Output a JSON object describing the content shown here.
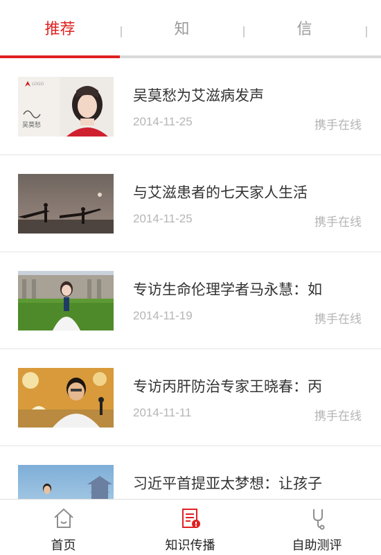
{
  "tabs": [
    {
      "label": "推荐",
      "active": true
    },
    {
      "label": "知",
      "active": false
    },
    {
      "label": "信",
      "active": false
    }
  ],
  "articles": [
    {
      "title": "吴莫愁为艾滋病发声",
      "date": "2014-11-25",
      "source": "携手在线",
      "thumb_icon": "portrait-woman-red-ribbon"
    },
    {
      "title": "与艾滋患者的七天家人生活",
      "date": "2014-11-25",
      "source": "携手在线",
      "thumb_icon": "silhouette-dancers-sunset"
    },
    {
      "title": "专访生命伦理学者马永慧：如",
      "date": "2014-11-19",
      "source": "携手在线",
      "thumb_icon": "woman-on-campus-lawn"
    },
    {
      "title": "专访丙肝防治专家王晓春：丙",
      "date": "2014-11-11",
      "source": "携手在线",
      "thumb_icon": "man-speaking-at-microphone"
    },
    {
      "title": "习近平首提亚太梦想：让孩子",
      "date": "",
      "source": "",
      "thumb_icon": "speaker-with-temple"
    }
  ],
  "bottom_nav": [
    {
      "label": "首页",
      "icon": "home-icon",
      "active": false
    },
    {
      "label": "知识传播",
      "icon": "document-icon",
      "active": true
    },
    {
      "label": "自助测评",
      "icon": "stethoscope-icon",
      "active": false
    }
  ],
  "colors": {
    "accent": "#e02020",
    "text": "#333333",
    "muted": "#b5b5b5"
  }
}
